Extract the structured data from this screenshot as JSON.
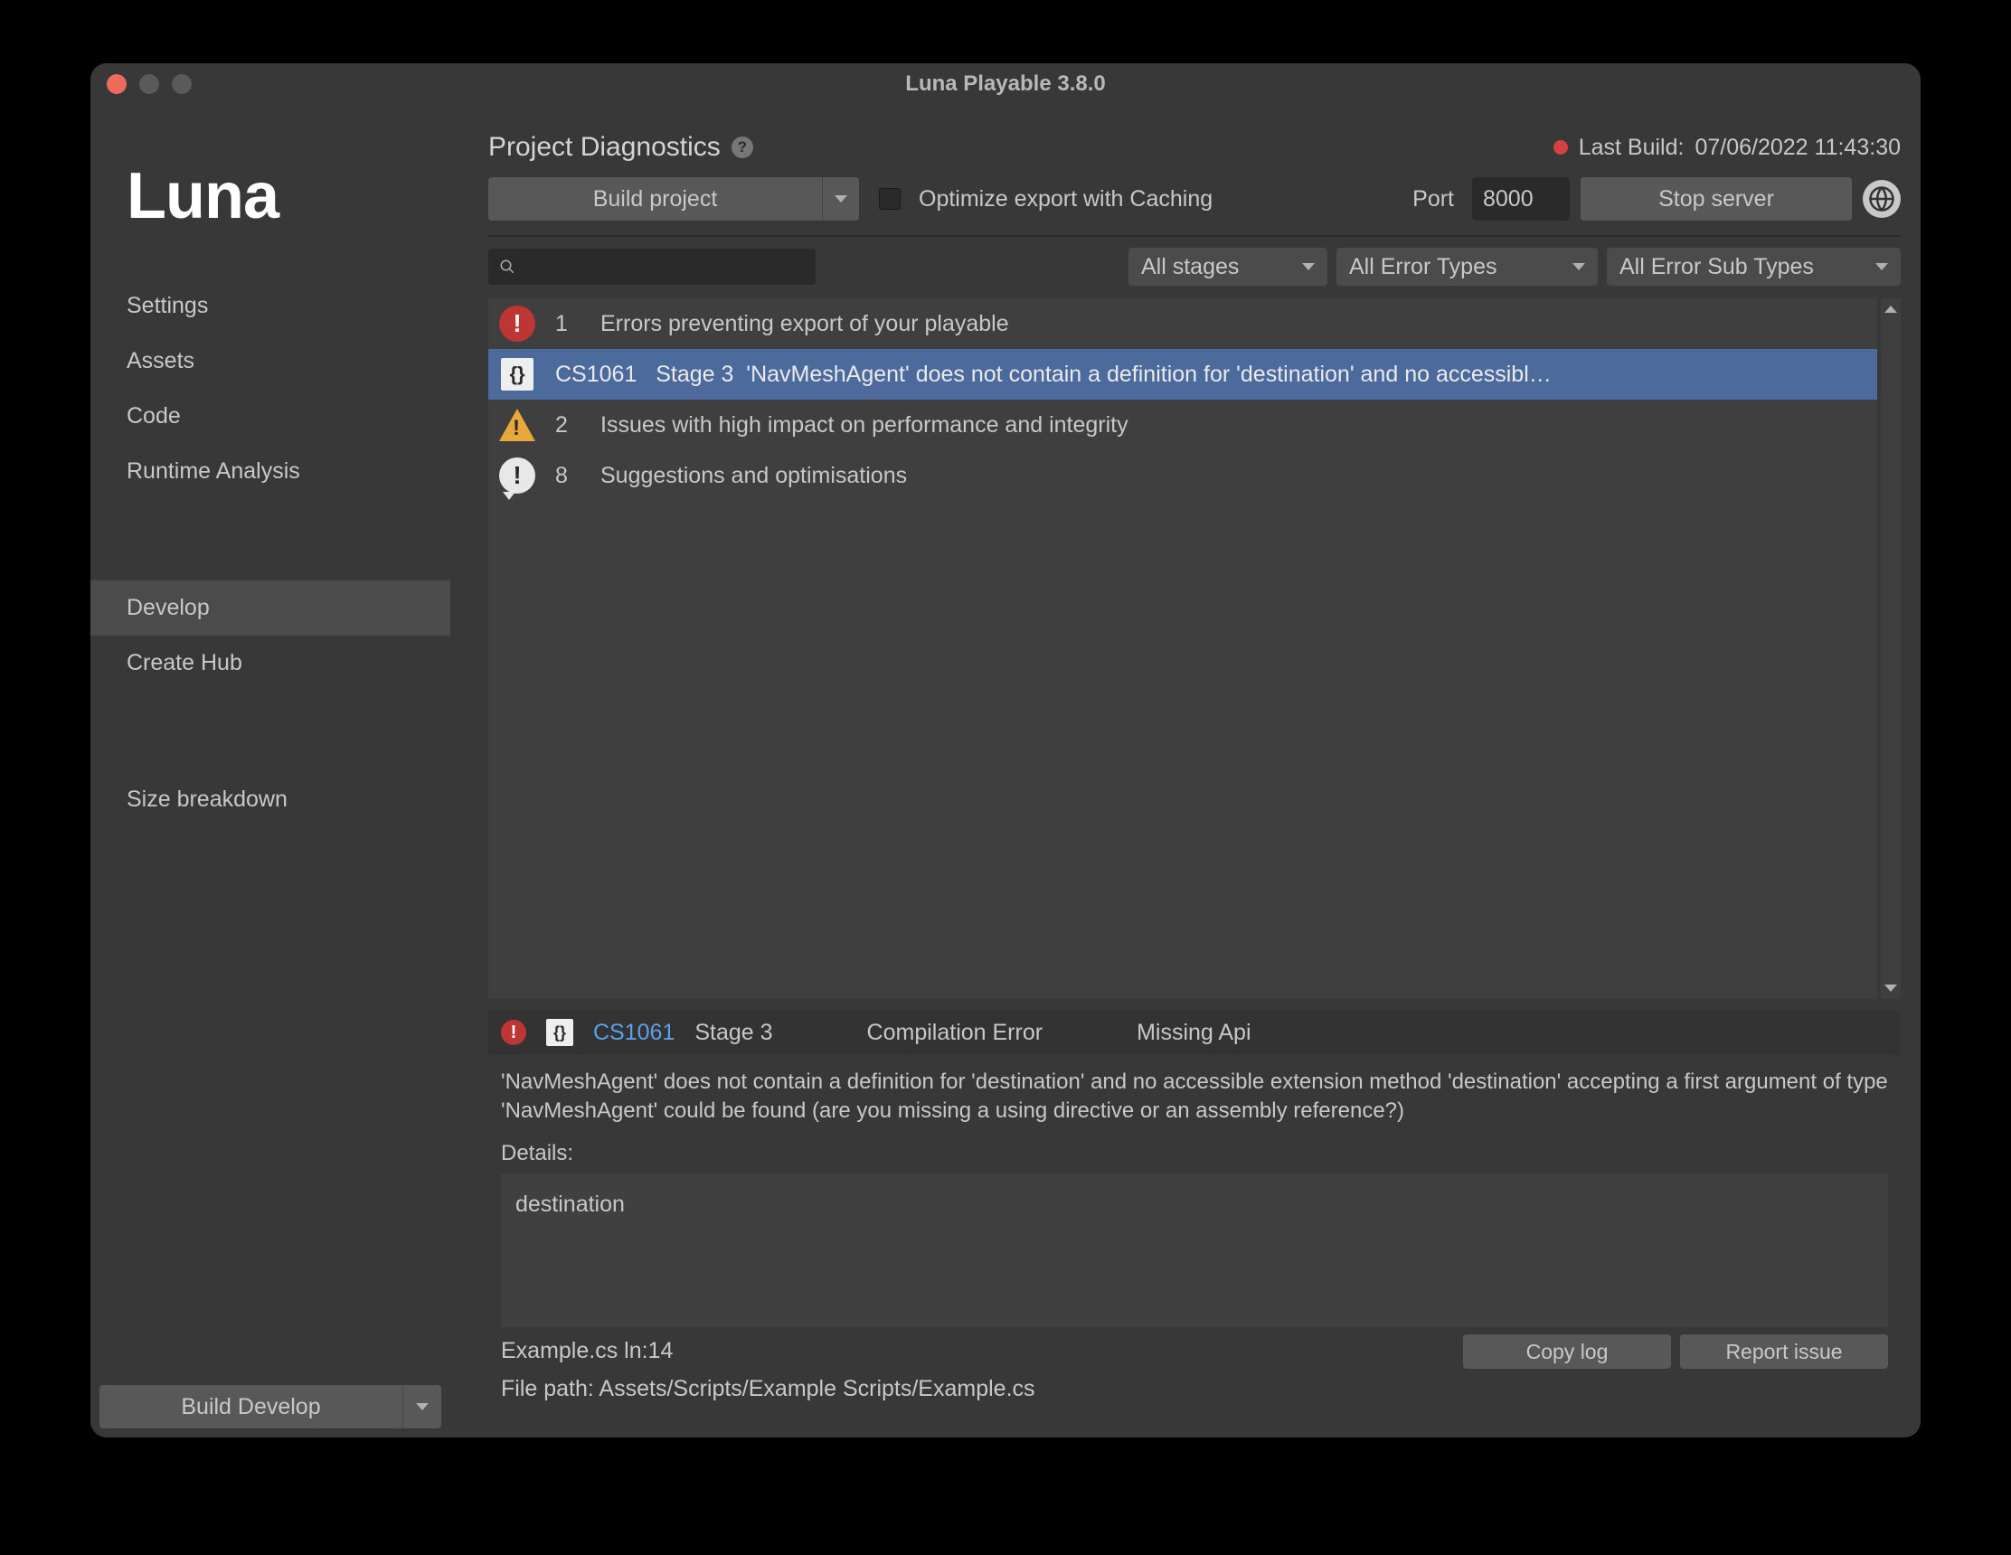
{
  "window_title": "Luna Playable 3.8.0",
  "logo": "Luna",
  "sidebar": {
    "items": [
      "Settings",
      "Assets",
      "Code",
      "Runtime Analysis"
    ],
    "group2": [
      "Develop",
      "Create Hub"
    ],
    "group3": [
      "Size breakdown"
    ],
    "active": "Develop",
    "build_develop": "Build Develop"
  },
  "header": {
    "title": "Project Diagnostics",
    "last_build_label": "Last Build:",
    "last_build_value": "07/06/2022 11:43:30"
  },
  "toolbar": {
    "build_project": "Build project",
    "optimize": "Optimize export with Caching",
    "port_label": "Port",
    "port_value": "8000",
    "stop_server": "Stop server"
  },
  "filters": {
    "stages": "All stages",
    "error_types": "All Error Types",
    "error_sub_types": "All Error Sub Types"
  },
  "issues": [
    {
      "kind": "error",
      "count": "1",
      "text": "Errors preventing export of your playable"
    },
    {
      "kind": "code",
      "count": "",
      "code": "CS1061",
      "stage": "Stage 3",
      "text": "'NavMeshAgent' does not contain a definition for 'destination' and no accessibl…",
      "selected": true
    },
    {
      "kind": "warn",
      "count": "2",
      "text": "Issues with high impact on performance and integrity"
    },
    {
      "kind": "info",
      "count": "8",
      "text": "Suggestions and optimisations"
    }
  ],
  "detail": {
    "code": "CS1061",
    "stage": "Stage 3",
    "category": "Compilation Error",
    "subcategory": "Missing Api",
    "message": "'NavMeshAgent' does not contain a definition for 'destination' and no accessible extension method 'destination' accepting a first argument of type 'NavMeshAgent' could be found (are you missing a using directive or an assembly reference?)",
    "details_label": "Details:",
    "details_value": "destination",
    "file_ref": "Example.cs ln:14",
    "file_path_label": "File path:",
    "file_path": "Assets/Scripts/Example Scripts/Example.cs",
    "copy_log": "Copy log",
    "report_issue": "Report issue"
  }
}
